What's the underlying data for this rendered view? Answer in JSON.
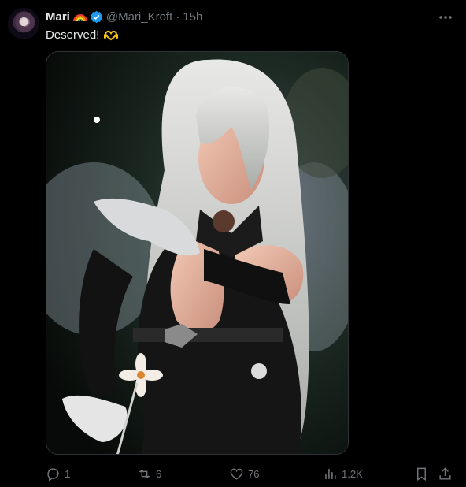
{
  "post": {
    "author_name": "Mari",
    "handle": "@Mari_Kroft",
    "separator": "·",
    "time": "15h",
    "text": "Deserved!"
  },
  "actions": {
    "replies": "1",
    "reposts": "6",
    "likes": "76",
    "views": "1.2K"
  },
  "colors": {
    "background": "#000000",
    "text": "#e7e9ea",
    "muted": "#71767b",
    "verified": "#1d9bf0"
  },
  "icons": [
    "rainbow-emoji",
    "verified-badge-icon",
    "more-icon",
    "heart-hands-emoji",
    "reply-icon",
    "repost-icon",
    "like-icon",
    "views-icon",
    "bookmark-icon",
    "share-icon"
  ]
}
